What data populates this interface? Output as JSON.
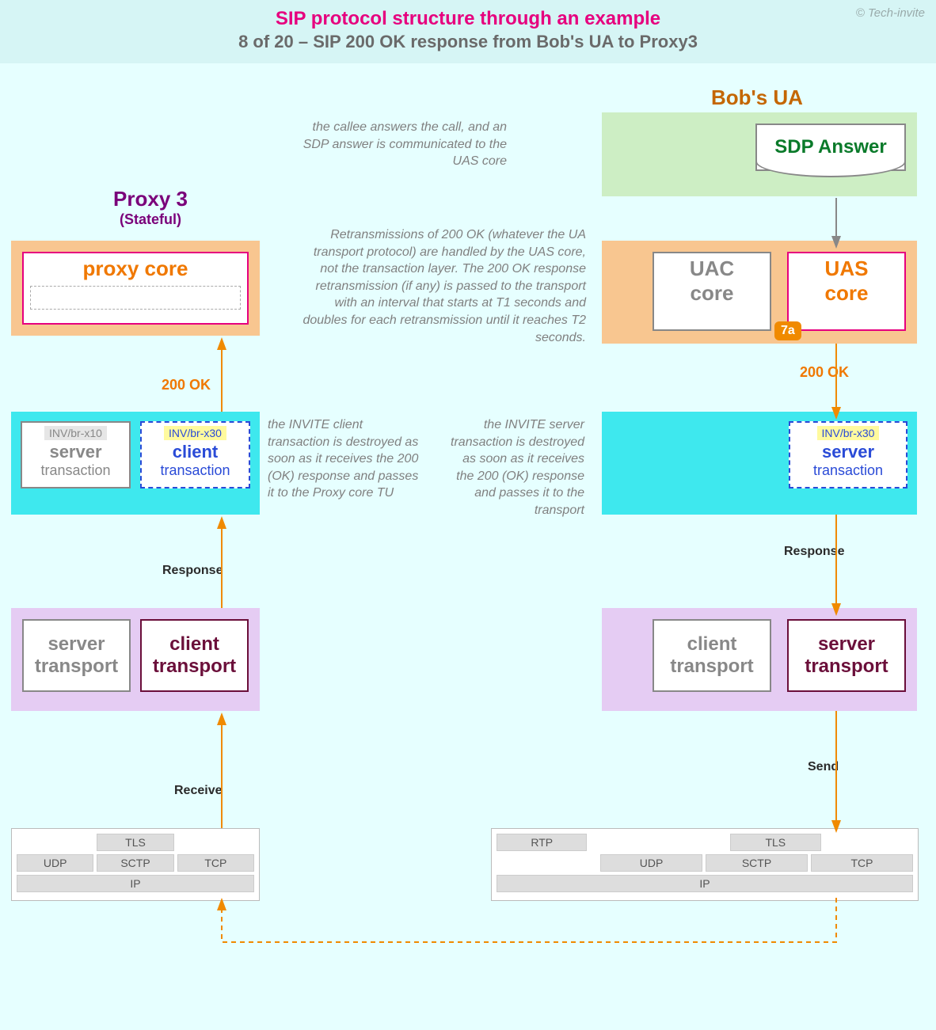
{
  "copyright": "© Tech-invite",
  "header": {
    "title": "SIP protocol structure through an example",
    "subtitle": "8 of 20 – SIP 200 OK response from Bob's UA to Proxy3"
  },
  "proxy3": {
    "title": "Proxy 3",
    "subtitle": "(Stateful)",
    "core_label": "proxy core",
    "server_trans": {
      "tag": "INV/br-x10",
      "l1": "server",
      "l2": "transaction"
    },
    "client_trans": {
      "tag": "INV/br-x30",
      "l1": "client",
      "l2": "transaction"
    },
    "server_tp": {
      "l1": "server",
      "l2": "transport"
    },
    "client_tp": {
      "l1": "client",
      "l2": "transport"
    }
  },
  "bob": {
    "title": "Bob's UA",
    "sdp": "SDP Answer",
    "uac": {
      "l1": "UAC",
      "l2": "core"
    },
    "uas": {
      "l1": "UAS",
      "l2": "core"
    },
    "badge": "7a",
    "server_trans": {
      "tag": "INV/br-x30",
      "l1": "server",
      "l2": "transaction"
    },
    "client_tp": {
      "l1": "client",
      "l2": "transport"
    },
    "server_tp": {
      "l1": "server",
      "l2": "transport"
    }
  },
  "stack_left": {
    "tls": "TLS",
    "udp": "UDP",
    "sctp": "SCTP",
    "tcp": "TCP",
    "ip": "IP"
  },
  "stack_right": {
    "rtp": "RTP",
    "tls": "TLS",
    "udp": "UDP",
    "sctp": "SCTP",
    "tcp": "TCP",
    "ip": "IP"
  },
  "labels": {
    "ok200_left": "200 OK",
    "ok200_right": "200 OK",
    "response_left": "Response",
    "response_right": "Response",
    "receive": "Receive",
    "send": "Send"
  },
  "notes": {
    "n1": "the callee answers the call, and an SDP answer is communicated to the UAS core",
    "n2": "Retransmissions of 200 OK (whatever the UA transport protocol) are handled by the UAS core, not the transaction layer. The 200 OK response retransmission (if any) is passed to the transport with an interval that starts at T1 seconds and doubles for each retransmission until it reaches T2 seconds.",
    "n3": "the INVITE client transaction is destroyed as soon as it receives the 200 (OK) response and passes it to the Proxy core TU",
    "n4": "the INVITE server transaction is destroyed as soon as it receives the 200 (OK) response and passes it to the transport"
  }
}
